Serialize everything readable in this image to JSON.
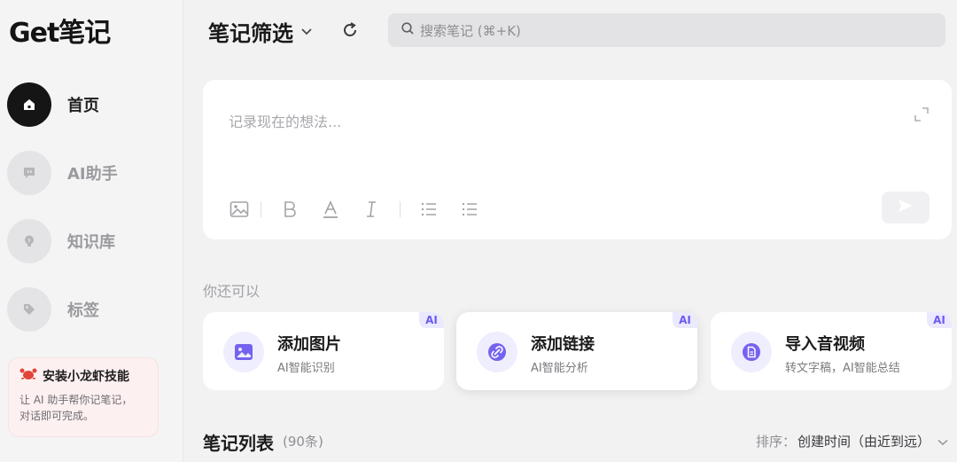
{
  "app": {
    "logo": "Get笔记"
  },
  "sidebar": {
    "items": [
      {
        "label": "首页",
        "icon": "home-icon",
        "active": true
      },
      {
        "label": "AI助手",
        "icon": "chat-bot-icon",
        "active": false
      },
      {
        "label": "知识库",
        "icon": "bulb-icon",
        "active": false
      },
      {
        "label": "标签",
        "icon": "tag-icon",
        "active": false
      }
    ],
    "promo": {
      "title": "安装小龙虾技能",
      "desc_line1": "让 AI 助手帮你记笔记，",
      "desc_line2": "对话即可完成。"
    }
  },
  "header": {
    "title": "笔记筛选",
    "search_placeholder": "搜索笔记 (⌘+K)"
  },
  "editor": {
    "placeholder": "记录现在的想法..."
  },
  "suggestions": {
    "hint": "你还可以",
    "badge": "AI",
    "cards": [
      {
        "title": "添加图片",
        "subtitle": "AI智能识别",
        "icon": "image-icon"
      },
      {
        "title": "添加链接",
        "subtitle": "AI智能分析",
        "icon": "link-icon"
      },
      {
        "title": "导入音视频",
        "subtitle": "转文字稿，AI智能总结",
        "icon": "document-icon"
      }
    ]
  },
  "notes": {
    "title": "笔记列表",
    "count": "(90条)",
    "sort_label": "排序：",
    "sort_value": "创建时间（由近到远）"
  },
  "colors": {
    "accent": "#6b5cf0",
    "active_nav": "#151515",
    "background": "#f2f2f3"
  }
}
